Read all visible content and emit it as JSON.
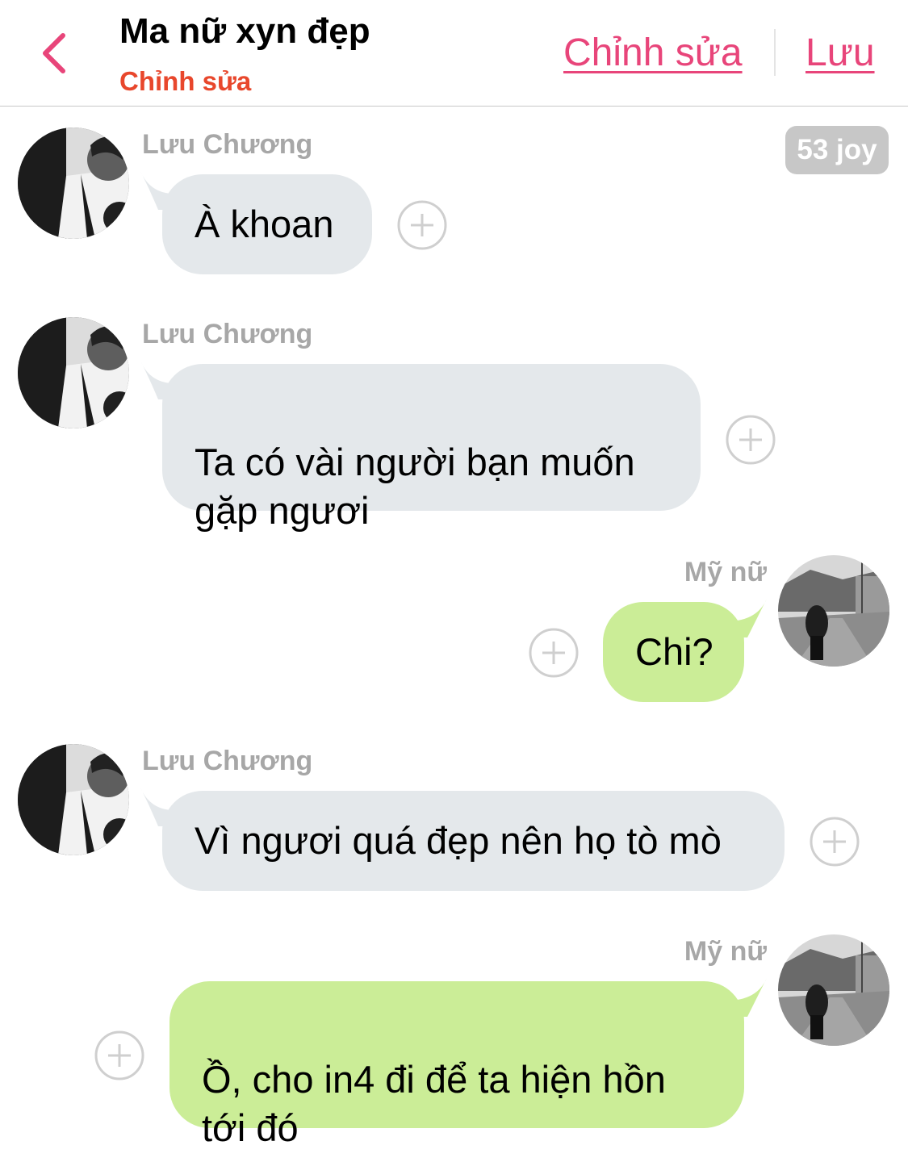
{
  "header": {
    "title": "Ma nữ xyn đẹp",
    "subtitle": "Chỉnh sửa",
    "edit_label": "Chỉnh sửa",
    "save_label": "Lưu",
    "back_icon": "chevron-left-icon",
    "accent_color": "#e8457a",
    "subtitle_color": "#e8472c"
  },
  "joy_badge": "53 joy",
  "messages": [
    {
      "side": "left",
      "sender": "Lưu Chương",
      "text": "À khoan"
    },
    {
      "side": "left",
      "sender": "Lưu Chương",
      "text": "Ta có vài người bạn muốn\ngặp ngươi"
    },
    {
      "side": "right",
      "sender": "Mỹ nữ",
      "text": "Chi?"
    },
    {
      "side": "left",
      "sender": "Lưu Chương",
      "text": "Vì ngươi quá đẹp nên họ tò mò"
    },
    {
      "side": "right",
      "sender": "Mỹ nữ",
      "text": "Ồ, cho in4 đi để ta hiện hồn\ntới đó"
    }
  ],
  "colors": {
    "left_bubble": "#e4e8eb",
    "right_bubble": "#cbed97",
    "sender_text": "#a7a7a7",
    "badge_bg": "#c7c7c7"
  },
  "icons": {
    "add": "plus-circle-icon",
    "avatar_left": "avatar-luu-chuong",
    "avatar_right": "avatar-my-nu"
  }
}
